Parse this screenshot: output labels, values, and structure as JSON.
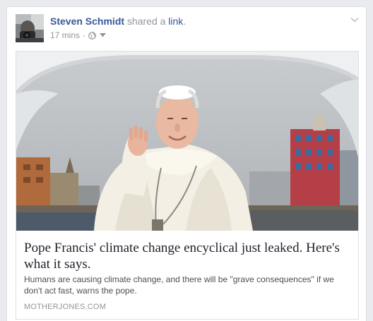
{
  "post": {
    "author": "Steven Schmidt",
    "action_text": "shared a",
    "action_link": "link",
    "action_suffix": ".",
    "timestamp": "17 mins",
    "separator": "·",
    "audience_icon": "globe-icon",
    "options_icon": "chevron-down-icon"
  },
  "attachment": {
    "title": "Pope Francis' climate change encyclical just leaked. Here's what it says.",
    "description": "Humans are causing climate change, and there will be \"grave consequences\" if we don't act fast, warns the pope.",
    "source": "MOTHERJONES.COM"
  },
  "colors": {
    "page_bg": "#e9ebee",
    "author_link": "#365899",
    "muted": "#90949c",
    "title": "#1d2129",
    "description": "#4b4f56"
  }
}
